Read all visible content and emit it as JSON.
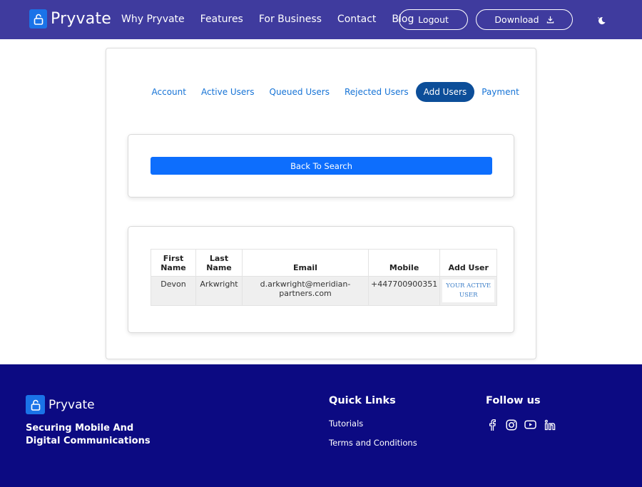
{
  "header": {
    "brand": "Pryvate",
    "nav": [
      "Why Pryvate",
      "Features",
      "For Business",
      "Contact",
      "Blog"
    ],
    "logout_label": "Logout",
    "download_label": "Download",
    "icons": {
      "logo": "lock-icon",
      "download": "download-icon",
      "theme": "moon-icon"
    }
  },
  "tabs": [
    "Account",
    "Active Users",
    "Queued Users",
    "Rejected Users",
    "Add Users",
    "Payment"
  ],
  "active_tab": "Add Users",
  "search_panel": {
    "back_label": "Back To Search"
  },
  "users_table": {
    "headers": [
      "First Name",
      "Last Name",
      "Email",
      "Mobile",
      "Add User"
    ],
    "rows": [
      {
        "first_name": "Devon",
        "last_name": "Arkwright",
        "email": "d.arkwright@meridian-partners.com",
        "mobile": "+447700900351",
        "add_user": "YOUR ACTIVE USER"
      }
    ]
  },
  "footer": {
    "brand": "Pryvate",
    "tagline": "Securing Mobile And Digital Communications",
    "quick_links_heading": "Quick Links",
    "quick_links": [
      "Tutorials",
      "Terms and Conditions"
    ],
    "follow_heading": "Follow us",
    "social_icons": [
      "facebook-icon",
      "instagram-icon",
      "youtube-icon",
      "linkedin-icon"
    ]
  },
  "colors": {
    "header_bg": "#3f3b9e",
    "footer_bg": "#0c0a82",
    "accent": "#0d6efd",
    "active_tab": "#0c4e99",
    "link": "#1673d6"
  }
}
